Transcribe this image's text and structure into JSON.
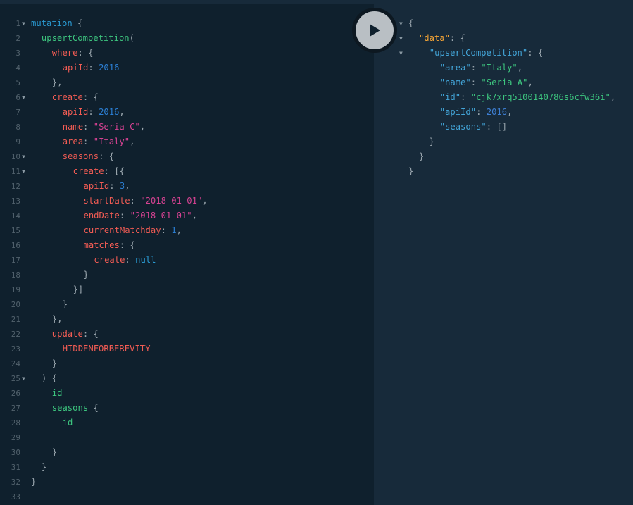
{
  "editor": {
    "lines": [
      {
        "n": "1",
        "fold": true,
        "indent": 0,
        "t": [
          [
            "kw",
            "mutation"
          ],
          [
            "pun",
            " {"
          ]
        ]
      },
      {
        "n": "2",
        "fold": false,
        "indent": 1,
        "t": [
          [
            "fn",
            "upsertCompetition"
          ],
          [
            "pun",
            "("
          ]
        ]
      },
      {
        "n": "3",
        "fold": false,
        "indent": 2,
        "t": [
          [
            "arg",
            "where"
          ],
          [
            "pun",
            ": {"
          ]
        ]
      },
      {
        "n": "4",
        "fold": false,
        "indent": 3,
        "t": [
          [
            "arg",
            "apiId"
          ],
          [
            "pun",
            ": "
          ],
          [
            "num",
            "2016"
          ]
        ]
      },
      {
        "n": "5",
        "fold": false,
        "indent": 2,
        "t": [
          [
            "pun",
            "},"
          ]
        ]
      },
      {
        "n": "6",
        "fold": true,
        "indent": 2,
        "t": [
          [
            "arg",
            "create"
          ],
          [
            "pun",
            ": {"
          ]
        ]
      },
      {
        "n": "7",
        "fold": false,
        "indent": 3,
        "t": [
          [
            "arg",
            "apiId"
          ],
          [
            "pun",
            ": "
          ],
          [
            "num",
            "2016"
          ],
          [
            "pun",
            ","
          ]
        ]
      },
      {
        "n": "8",
        "fold": false,
        "indent": 3,
        "t": [
          [
            "arg",
            "name"
          ],
          [
            "pun",
            ": "
          ],
          [
            "str",
            "\"Seria C\""
          ],
          [
            "pun",
            ","
          ]
        ]
      },
      {
        "n": "9",
        "fold": false,
        "indent": 3,
        "t": [
          [
            "arg",
            "area"
          ],
          [
            "pun",
            ": "
          ],
          [
            "str",
            "\"Italy\""
          ],
          [
            "pun",
            ","
          ]
        ]
      },
      {
        "n": "10",
        "fold": true,
        "indent": 3,
        "t": [
          [
            "arg",
            "seasons"
          ],
          [
            "pun",
            ": {"
          ]
        ]
      },
      {
        "n": "11",
        "fold": true,
        "indent": 4,
        "t": [
          [
            "arg",
            "create"
          ],
          [
            "pun",
            ": [{"
          ]
        ]
      },
      {
        "n": "12",
        "fold": false,
        "indent": 5,
        "t": [
          [
            "arg",
            "apiId"
          ],
          [
            "pun",
            ": "
          ],
          [
            "num",
            "3"
          ],
          [
            "pun",
            ","
          ]
        ]
      },
      {
        "n": "13",
        "fold": false,
        "indent": 5,
        "t": [
          [
            "arg",
            "startDate"
          ],
          [
            "pun",
            ": "
          ],
          [
            "str",
            "\"2018-01-01\""
          ],
          [
            "pun",
            ","
          ]
        ]
      },
      {
        "n": "14",
        "fold": false,
        "indent": 5,
        "t": [
          [
            "arg",
            "endDate"
          ],
          [
            "pun",
            ": "
          ],
          [
            "str",
            "\"2018-01-01\""
          ],
          [
            "pun",
            ","
          ]
        ]
      },
      {
        "n": "15",
        "fold": false,
        "indent": 5,
        "t": [
          [
            "arg",
            "currentMatchday"
          ],
          [
            "pun",
            ": "
          ],
          [
            "num",
            "1"
          ],
          [
            "pun",
            ","
          ]
        ]
      },
      {
        "n": "16",
        "fold": false,
        "indent": 5,
        "t": [
          [
            "arg",
            "matches"
          ],
          [
            "pun",
            ": {"
          ]
        ]
      },
      {
        "n": "17",
        "fold": false,
        "indent": 6,
        "t": [
          [
            "arg",
            "create"
          ],
          [
            "pun",
            ": "
          ],
          [
            "kw",
            "null"
          ]
        ]
      },
      {
        "n": "18",
        "fold": false,
        "indent": 5,
        "t": [
          [
            "pun",
            "}"
          ]
        ]
      },
      {
        "n": "19",
        "fold": false,
        "indent": 4,
        "t": [
          [
            "pun",
            "}]"
          ]
        ]
      },
      {
        "n": "20",
        "fold": false,
        "indent": 3,
        "t": [
          [
            "pun",
            "}"
          ]
        ]
      },
      {
        "n": "21",
        "fold": false,
        "indent": 2,
        "t": [
          [
            "pun",
            "},"
          ]
        ]
      },
      {
        "n": "22",
        "fold": false,
        "indent": 2,
        "t": [
          [
            "arg",
            "update"
          ],
          [
            "pun",
            ": {"
          ]
        ]
      },
      {
        "n": "23",
        "fold": false,
        "indent": 3,
        "t": [
          [
            "enum",
            "HIDDENFORBEREVITY"
          ]
        ]
      },
      {
        "n": "24",
        "fold": false,
        "indent": 2,
        "t": [
          [
            "pun",
            "}"
          ]
        ]
      },
      {
        "n": "25",
        "fold": true,
        "indent": 1,
        "t": [
          [
            "pun",
            ") {"
          ]
        ]
      },
      {
        "n": "26",
        "fold": false,
        "indent": 2,
        "t": [
          [
            "fld",
            "id"
          ]
        ]
      },
      {
        "n": "27",
        "fold": false,
        "indent": 2,
        "t": [
          [
            "fld",
            "seasons"
          ],
          [
            "pun",
            " {"
          ]
        ]
      },
      {
        "n": "28",
        "fold": false,
        "indent": 3,
        "t": [
          [
            "fld",
            "id"
          ]
        ]
      },
      {
        "n": "29",
        "fold": false,
        "indent": 0,
        "t": []
      },
      {
        "n": "30",
        "fold": false,
        "indent": 2,
        "t": [
          [
            "pun",
            "}"
          ]
        ]
      },
      {
        "n": "31",
        "fold": false,
        "indent": 1,
        "t": [
          [
            "pun",
            "}"
          ]
        ]
      },
      {
        "n": "32",
        "fold": false,
        "indent": 0,
        "t": [
          [
            "pun",
            "}"
          ]
        ]
      },
      {
        "n": "33",
        "fold": false,
        "indent": 0,
        "t": []
      }
    ]
  },
  "execute_button": {
    "icon": "play-icon",
    "label": "Execute Query"
  },
  "result": {
    "lines": [
      {
        "fold": true,
        "indent": 0,
        "t": [
          [
            "pun",
            "{"
          ]
        ]
      },
      {
        "fold": true,
        "indent": 1,
        "t": [
          [
            "rdata",
            "\"data\""
          ],
          [
            "pun",
            ": {"
          ]
        ]
      },
      {
        "fold": true,
        "indent": 2,
        "t": [
          [
            "rkey",
            "\"upsertCompetition\""
          ],
          [
            "pun",
            ": {"
          ]
        ]
      },
      {
        "fold": false,
        "indent": 3,
        "t": [
          [
            "rkey",
            "\"area\""
          ],
          [
            "pun",
            ": "
          ],
          [
            "rstr",
            "\"Italy\""
          ],
          [
            "pun",
            ","
          ]
        ]
      },
      {
        "fold": false,
        "indent": 3,
        "t": [
          [
            "rkey",
            "\"name\""
          ],
          [
            "pun",
            ": "
          ],
          [
            "rstr",
            "\"Seria A\""
          ],
          [
            "pun",
            ","
          ]
        ]
      },
      {
        "fold": false,
        "indent": 3,
        "t": [
          [
            "rkey",
            "\"id\""
          ],
          [
            "pun",
            ": "
          ],
          [
            "rstr",
            "\"cjk7xrq5100140786s6cfw36i\""
          ],
          [
            "pun",
            ","
          ]
        ]
      },
      {
        "fold": false,
        "indent": 3,
        "t": [
          [
            "rkey",
            "\"apiId\""
          ],
          [
            "pun",
            ": "
          ],
          [
            "rnum",
            "2016"
          ],
          [
            "pun",
            ","
          ]
        ]
      },
      {
        "fold": false,
        "indent": 3,
        "t": [
          [
            "rkey",
            "\"seasons\""
          ],
          [
            "pun",
            ": []"
          ]
        ]
      },
      {
        "fold": false,
        "indent": 2,
        "t": [
          [
            "pun",
            "}"
          ]
        ]
      },
      {
        "fold": false,
        "indent": 1,
        "t": [
          [
            "pun",
            "}"
          ]
        ]
      },
      {
        "fold": false,
        "indent": 0,
        "t": [
          [
            "pun",
            "}"
          ]
        ]
      }
    ]
  }
}
